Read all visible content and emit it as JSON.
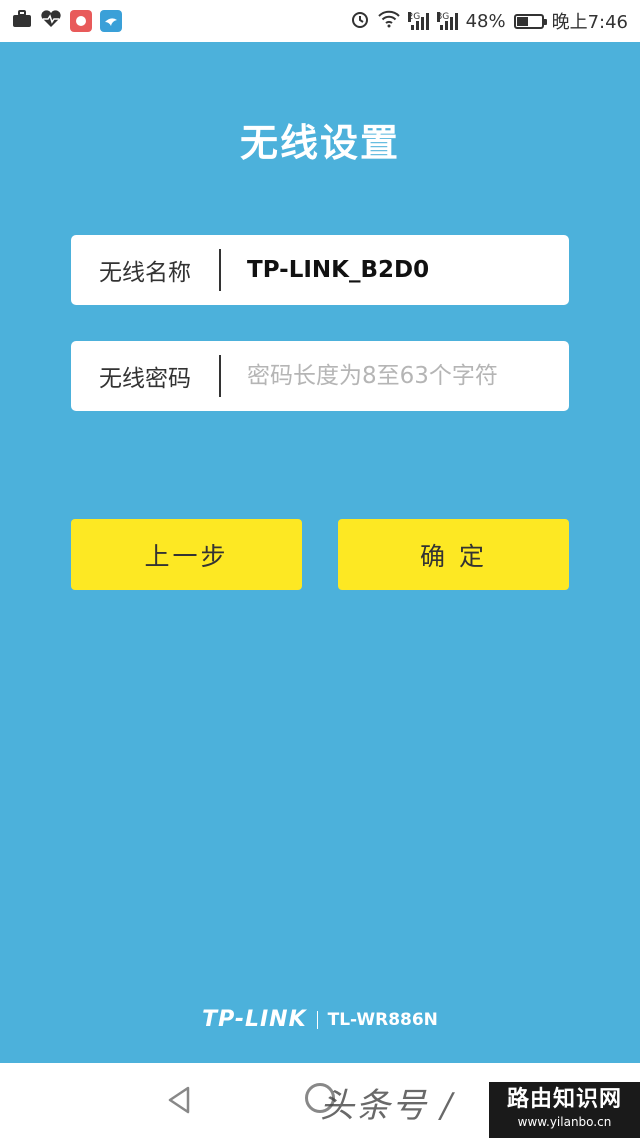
{
  "status_bar": {
    "signal_2g_label": "2G",
    "signal_3g_label": "3G",
    "battery_percent_text": "48%",
    "battery_level": 0.48,
    "time": "晚上7:46",
    "app_icon_colors": [
      "#e85a5a",
      "#3aa0d8"
    ]
  },
  "page": {
    "title": "无线设置"
  },
  "form": {
    "ssid_label": "无线名称",
    "ssid_value": "TP-LINK_B2D0",
    "password_label": "无线密码",
    "password_placeholder": "密码长度为8至63个字符"
  },
  "buttons": {
    "back_label": "上一步",
    "confirm_label": "确 定"
  },
  "brand": {
    "logo": "TP-LINK",
    "model": "TL-WR886N"
  },
  "watermark": {
    "left_text": "头条号 /",
    "title": "路由知识网",
    "url": "www.yilanbo.cn"
  },
  "colors": {
    "background": "#4cb1db",
    "button": "#fde823",
    "field": "#ffffff"
  }
}
